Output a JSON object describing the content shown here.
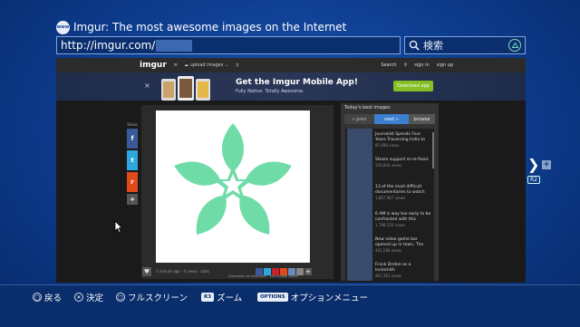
{
  "header": {
    "www_icon_text": "www",
    "page_title": "Imgur: The most awesome images on the Internet",
    "url": "http://imgur.com/",
    "search_label": "検索"
  },
  "imgur": {
    "logo": "imgur",
    "menu_icon": "≡",
    "upload_label": "upload images",
    "nav_right": {
      "search": "Search",
      "sign_in": "sign in",
      "sign_up": "sign up"
    },
    "banner": {
      "title": "Get the Imgur Mobile App!",
      "subtitle": "Fully Native. Totally Awesome.",
      "button": "Download app",
      "close": "×"
    },
    "share": {
      "label": "Share",
      "fb": "f",
      "tw": "t",
      "reddit": "r",
      "more": "+"
    },
    "image_footer": {
      "meta": "1 minute ago · 0 views · stats",
      "download": "Download full resolution · Get embed codes"
    },
    "sidebar": {
      "title": "Today's best images",
      "prev": "« prev",
      "next": "next »",
      "browse": "browse",
      "items": [
        {
          "title": "Journalist Spends Four Years Traversing India to",
          "views": "87,696 views"
        },
        {
          "title": "Steam support re-re-fixed.",
          "views": "545,842 views"
        },
        {
          "title": "13 of the most difficult documentaries to watch",
          "views": "1,867,987 views"
        },
        {
          "title": "6 AM is way too early to be confronted with this",
          "views": "1,788,520 views"
        },
        {
          "title": "New video game bar opened up in town. The",
          "views": "462,588 views"
        },
        {
          "title": "Frank Drebin as a locksmith",
          "views": "967,363 views"
        }
      ]
    },
    "colors": {
      "logo_green": "#6fdca7",
      "banner_button": "#85bf25",
      "next_tab": "#3b7fd0"
    }
  },
  "side_nav": {
    "r2_label": "R2",
    "plus": "+"
  },
  "bottom": {
    "back": "戻る",
    "confirm": "決定",
    "fullscreen": "フルスクリーン",
    "r3": "R3",
    "zoom": "ズーム",
    "options_key": "OPTIONS",
    "options_menu": "オプションメニュー"
  }
}
